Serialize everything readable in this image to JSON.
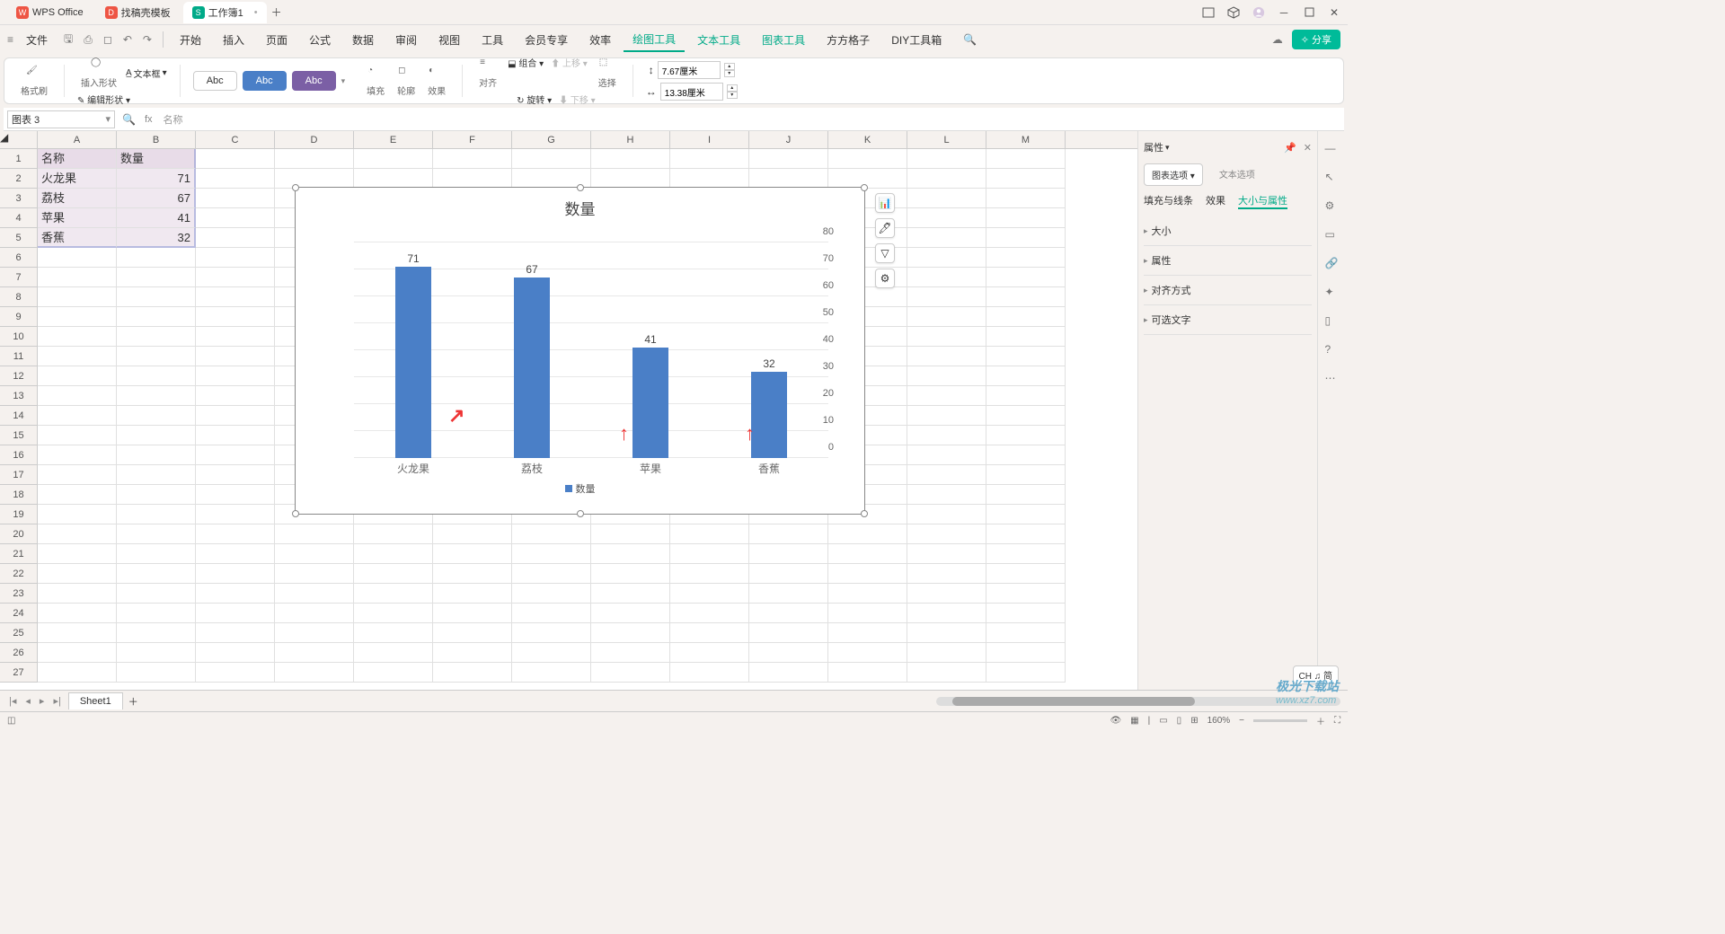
{
  "titlebar": {
    "app": "WPS Office",
    "tabs": [
      {
        "icon": "D",
        "iconbg": "#e54",
        "label": "找稿壳模板"
      },
      {
        "icon": "S",
        "iconbg": "#0a8",
        "label": "工作簿1",
        "active": true
      }
    ]
  },
  "menu": {
    "file": "文件",
    "items": [
      "开始",
      "插入",
      "页面",
      "公式",
      "数据",
      "审阅",
      "视图",
      "工具",
      "会员专享",
      "效率",
      "绘图工具",
      "文本工具",
      "图表工具",
      "方方格子",
      "DIY工具箱"
    ],
    "active_index": 10,
    "share": "分享"
  },
  "ribbon": {
    "format_paint": "格式刷",
    "insert_shape": "插入形状",
    "text_box": "文本框",
    "edit_shape": "编辑形状",
    "abc": "Abc",
    "fill": "填充",
    "outline": "轮廓",
    "effects": "效果",
    "align": "对齐",
    "group": "组合",
    "rotate": "旋转",
    "up": "上移",
    "down": "下移",
    "select": "选择",
    "width": "7.67厘米",
    "height": "13.38厘米"
  },
  "formula": {
    "namebox": "图表 3",
    "fx": "fx",
    "text": "名称"
  },
  "columns": [
    "A",
    "B",
    "C",
    "D",
    "E",
    "F",
    "G",
    "H",
    "I",
    "J",
    "K",
    "L",
    "M"
  ],
  "table": {
    "headers": [
      "名称",
      "数量"
    ],
    "rows": [
      [
        "火龙果",
        "71"
      ],
      [
        "荔枝",
        "67"
      ],
      [
        "苹果",
        "41"
      ],
      [
        "香蕉",
        "32"
      ]
    ]
  },
  "chart_data": {
    "type": "bar",
    "title": "数量",
    "categories": [
      "火龙果",
      "荔枝",
      "苹果",
      "香蕉"
    ],
    "values": [
      71,
      67,
      41,
      32
    ],
    "ylabel": "",
    "ylim": [
      0,
      80
    ],
    "yticks": [
      0,
      10,
      20,
      30,
      40,
      50,
      60,
      70,
      80
    ],
    "legend": "数量"
  },
  "rightpanel": {
    "title": "属性",
    "tab_chart": "图表选项",
    "tab_text": "文本选项",
    "subtabs": [
      "填充与线条",
      "效果",
      "大小与属性"
    ],
    "subtab_active": 2,
    "sections": [
      "大小",
      "属性",
      "对齐方式",
      "可选文字"
    ]
  },
  "sheets": {
    "name": "Sheet1"
  },
  "status": {
    "zoom": "160%",
    "ime": "CH ♫ 简"
  },
  "watermark": {
    "brand": "极光下载站",
    "url": "www.xz7.com"
  }
}
